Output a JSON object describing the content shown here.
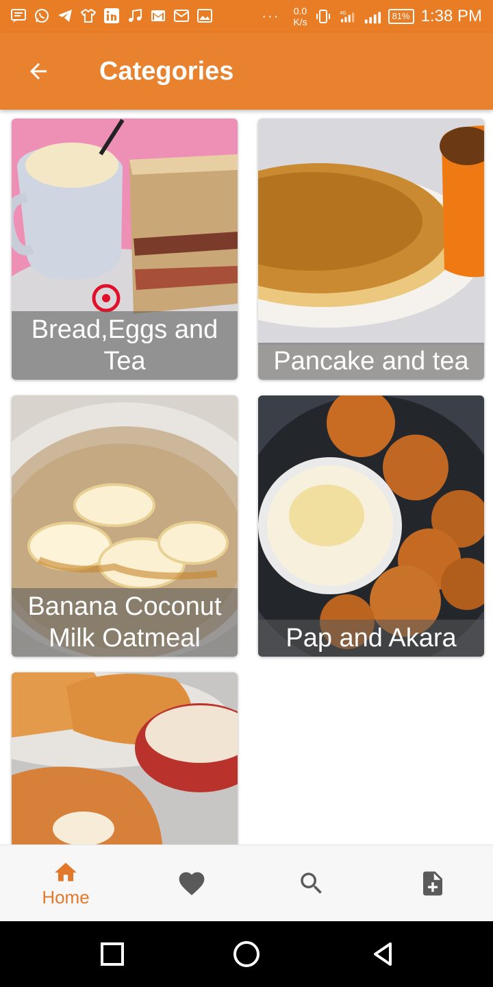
{
  "status_bar": {
    "netspeed_value": "0.0",
    "netspeed_unit": "K/s",
    "network": "4G",
    "battery": "81%",
    "time": "1:38 PM",
    "more": "···",
    "icons": [
      "message-icon",
      "whatsapp-icon",
      "telegram-icon",
      "shirt-icon",
      "linkedin-icon",
      "music-icon",
      "gmail-icon",
      "mail-icon",
      "image-icon"
    ]
  },
  "app_bar": {
    "title": "Categories"
  },
  "categories": [
    {
      "label": "Bread,Eggs and Tea"
    },
    {
      "label": "Pancake and tea"
    },
    {
      "label": "Banana Coconut Milk Oatmeal"
    },
    {
      "label": "Pap and Akara"
    },
    {
      "label": ""
    }
  ],
  "bottom_nav": {
    "items": [
      {
        "label": "Home",
        "icon": "home-icon",
        "active": true
      },
      {
        "label": "",
        "icon": "heart-icon",
        "active": false
      },
      {
        "label": "",
        "icon": "search-icon",
        "active": false
      },
      {
        "label": "",
        "icon": "add-document-icon",
        "active": false
      }
    ]
  },
  "colors": {
    "primary": "#e8822e",
    "status_bar": "#e87d26",
    "active_nav": "#e2782a",
    "inactive_nav": "#5a5a5a"
  }
}
